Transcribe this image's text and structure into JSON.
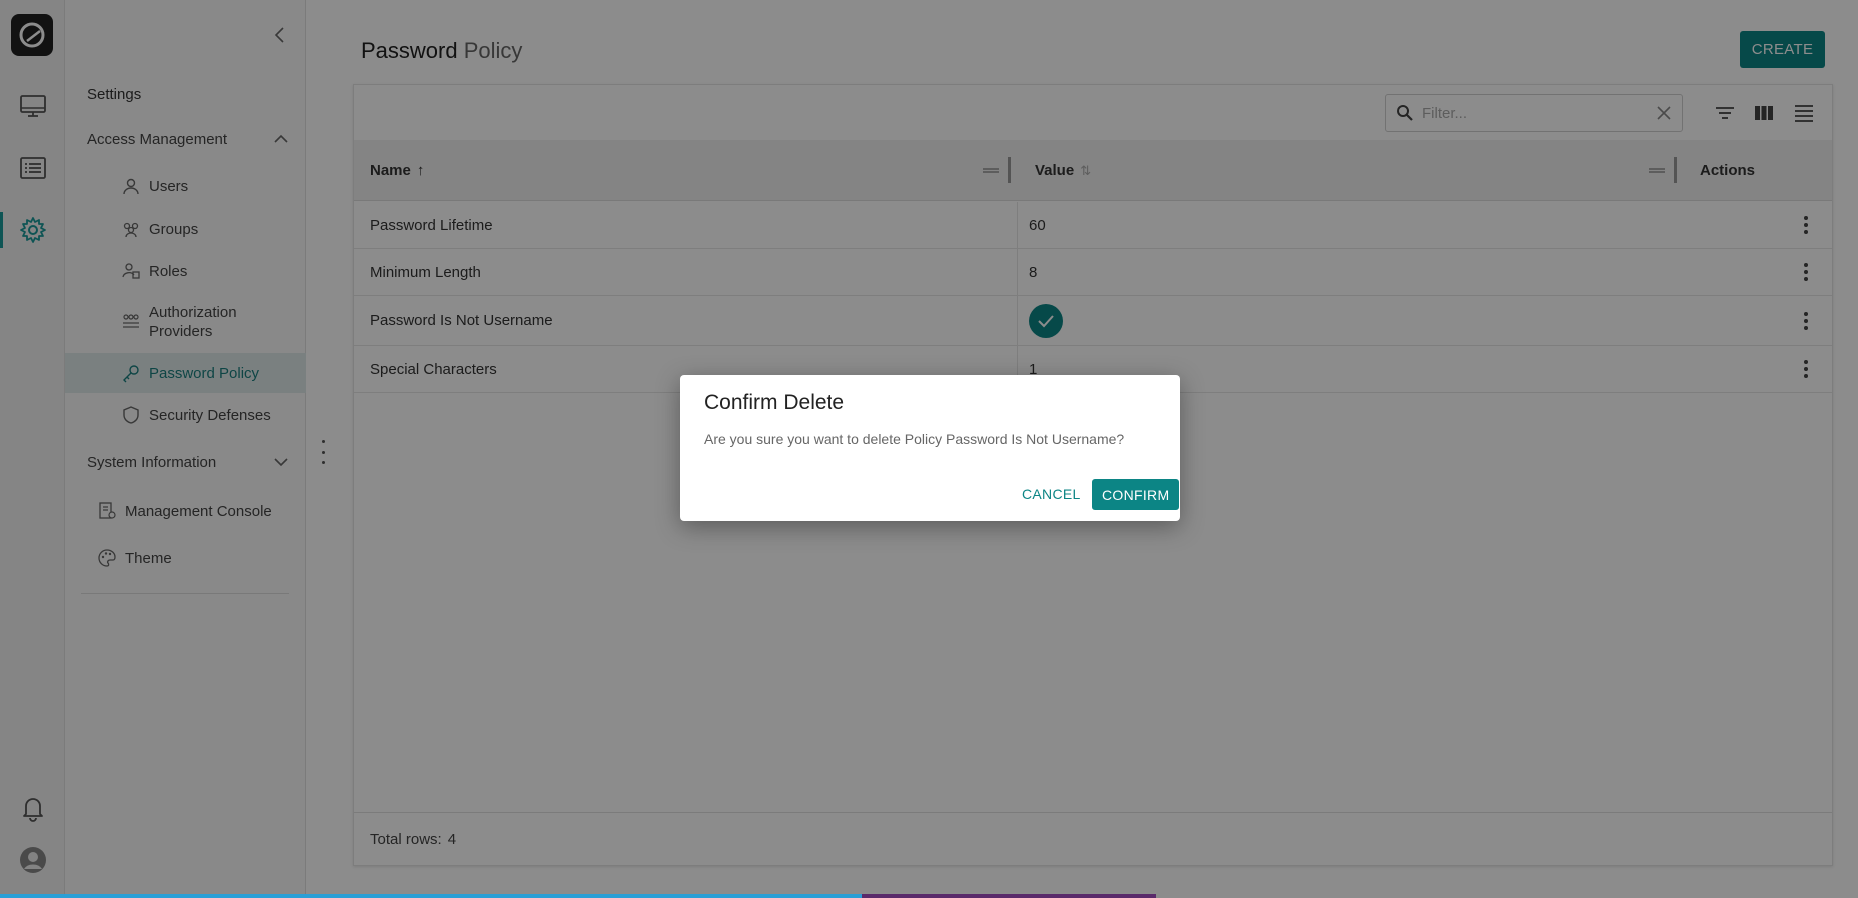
{
  "colors": {
    "accent": "#0c8585",
    "active_nav_bg": "#dfeaea"
  },
  "rail": {
    "items": [
      {
        "icon": "monitor-icon"
      },
      {
        "icon": "list-icon"
      },
      {
        "icon": "gear-icon",
        "active": true
      }
    ],
    "bottom": [
      {
        "icon": "bell-icon"
      },
      {
        "icon": "user-avatar-icon"
      }
    ]
  },
  "sidebar": {
    "title": "Settings",
    "access_management": {
      "label": "Access Management",
      "items": [
        {
          "label": "Users",
          "icon": "user-icon"
        },
        {
          "label": "Groups",
          "icon": "groups-icon"
        },
        {
          "label": "Roles",
          "icon": "roles-icon"
        },
        {
          "label": "Authorization Providers",
          "icon": "authorization-icon"
        },
        {
          "label": "Password Policy",
          "icon": "key-icon",
          "active": true
        },
        {
          "label": "Security Defenses",
          "icon": "shield-icon"
        }
      ]
    },
    "system_information": {
      "label": "System Information"
    },
    "extra_items": [
      {
        "label": "Management Console",
        "icon": "console-icon"
      },
      {
        "label": "Theme",
        "icon": "palette-icon"
      }
    ]
  },
  "header": {
    "title_bold": "Password",
    "title_light": "Policy",
    "create_label": "CREATE"
  },
  "toolbar": {
    "filter_placeholder": "Filter..."
  },
  "table": {
    "columns": [
      {
        "label": "Name",
        "sort": "↑"
      },
      {
        "label": "Value",
        "sort": "⇅"
      },
      {
        "label": "Actions"
      }
    ],
    "rows": [
      {
        "name": "Password Lifetime",
        "value": "60"
      },
      {
        "name": "Minimum Length",
        "value": "8"
      },
      {
        "name": "Password Is Not Username",
        "value": "",
        "value_is_check": true
      },
      {
        "name": "Special Characters",
        "value": "1"
      }
    ],
    "total_label": "Total rows:",
    "total_value": "4"
  },
  "dialog": {
    "title": "Confirm Delete",
    "message": "Are you sure you want to delete Policy Password Is Not Username?",
    "cancel_label": "CANCEL",
    "confirm_label": "CONFIRM"
  }
}
